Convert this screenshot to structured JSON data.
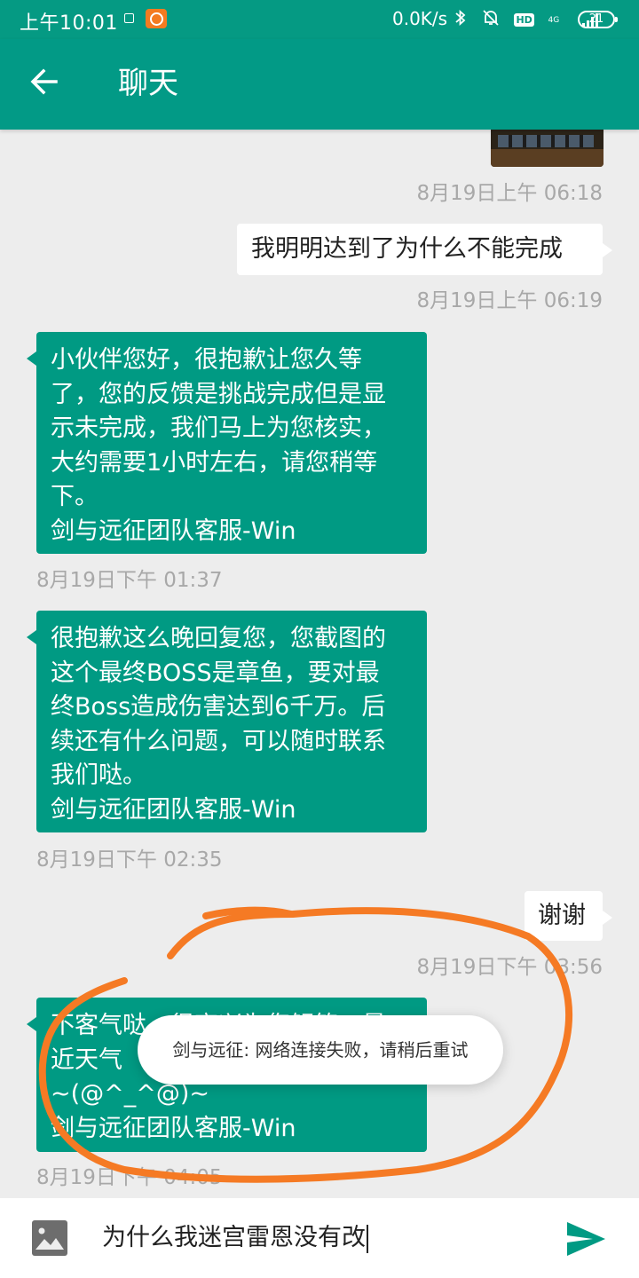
{
  "status_bar": {
    "time": "上午10:01",
    "net_speed": "0.0K/s",
    "hd_label": "HD",
    "network_type": "4G",
    "battery": "21"
  },
  "header": {
    "title": "聊天",
    "back_icon": "arrow-left-icon"
  },
  "messages": [
    {
      "type": "image",
      "direction": "out",
      "time": "8月19日上午 06:18"
    },
    {
      "type": "text",
      "direction": "out",
      "lines": [
        "我明明达到了为什么不能完成"
      ],
      "time": "8月19日上午 06:19"
    },
    {
      "type": "text",
      "direction": "in",
      "lines": [
        "小伙伴您好，很抱歉让您久等",
        "了，您的反馈是挑战完成但是显",
        "示未完成，我们马上为您核实，",
        "大约需要1小时左右，请您稍等",
        "下。",
        "剑与远征团队客服-Win"
      ],
      "time": "8月19日下午 01:37"
    },
    {
      "type": "text",
      "direction": "in",
      "lines": [
        "很抱歉这么晚回复您，您截图的",
        "这个最终BOSS是章鱼，要对最",
        "终Boss造成伤害达到6千万。后",
        "续还有什么问题，可以随时联系",
        "我们哒。",
        "剑与远征团队客服-Win"
      ],
      "time": "8月19日下午 02:35"
    },
    {
      "type": "text",
      "direction": "out",
      "lines": [
        "谢谢"
      ],
      "time": "8月19日下午 03:56"
    },
    {
      "type": "text",
      "direction": "in",
      "lines": [
        "不客气哒，很高兴为您解答，最",
        "近天气",
        "~(@^_^@)~",
        "剑与远征团队客服-Win"
      ],
      "time": "8月19日下午 04:05"
    }
  ],
  "toast": {
    "text": "剑与远征: 网络连接失败，请稍后重试"
  },
  "input": {
    "value": "为什么我迷宫雷恩没有改",
    "image_icon": "image-icon",
    "send_icon": "send-icon"
  },
  "colors": {
    "primary": "#029a86",
    "bubble_in": "#009a83",
    "bubble_out": "#ffffff",
    "background": "#ededed",
    "annotation": "#f57a24"
  }
}
